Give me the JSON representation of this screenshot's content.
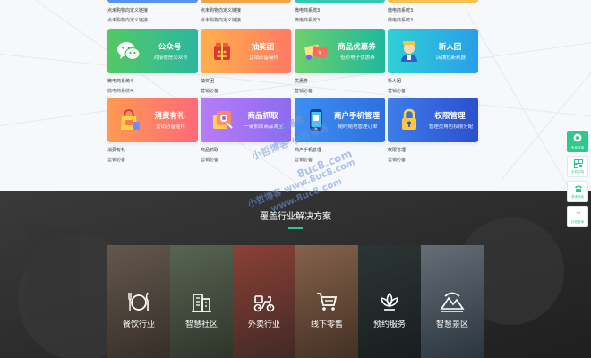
{
  "partial_row": [
    {
      "name": "点未购物向定义链接",
      "tag": "点未购物向定义链接",
      "color": "#5b8ff0"
    },
    {
      "name": "点未购物向定义链接",
      "tag": "点未购物向定义链接",
      "color": "#f5a24a"
    },
    {
      "name": "微电商系统3",
      "tag": "微电商系统3",
      "color": "#33c9b5"
    },
    {
      "name": "微电商系统3",
      "tag": "微电商系统3",
      "color": "#f3c24f"
    }
  ],
  "plugins": [
    {
      "title": "公众号",
      "subtitle": "对接微信公众号",
      "name": "微电商系统4",
      "tag": "微电商系统4",
      "icon": "wechat-icon",
      "colors": [
        "#52c964",
        "#2db6a0"
      ]
    },
    {
      "title": "抽奖团",
      "subtitle": "营销必备操作",
      "name": "抽奖团",
      "tag": "营销必备",
      "icon": "gift-box-icon",
      "colors": [
        "#ffb04a",
        "#ff7b63"
      ]
    },
    {
      "title": "商品优惠券",
      "subtitle": "低价电子优惠券",
      "name": "优惠券",
      "tag": "营销必备",
      "icon": "coupon-icon",
      "colors": [
        "#6dd06b",
        "#1fb89d"
      ]
    },
    {
      "title": "新人团",
      "subtitle": "店铺拉新利器",
      "name": "新人团",
      "tag": "营销必备",
      "icon": "new-user-icon",
      "colors": [
        "#2ed0d5",
        "#2a9ee8"
      ]
    },
    {
      "title": "消费有礼",
      "subtitle": "营销必备插件",
      "name": "消费有礼",
      "tag": "营销必备",
      "icon": "shopping-bag-icon",
      "colors": [
        "#ff9a52",
        "#ff6a78"
      ]
    },
    {
      "title": "商品抓取",
      "subtitle": "一键抓取商品淘宝",
      "name": "商品抓取",
      "tag": "营销必备",
      "icon": "product-grab-icon",
      "colors": [
        "#b77cf7",
        "#8b6bf0"
      ]
    },
    {
      "title": "商户手机管理",
      "subtitle": "随时随地管理订单",
      "name": "商户手机管理",
      "tag": "营销必备",
      "icon": "mobile-phone-icon",
      "colors": [
        "#3d8ff2",
        "#2e6fe0"
      ]
    },
    {
      "title": "权限管理",
      "subtitle": "管理员角色权限分配",
      "name": "权限管理",
      "tag": "营销必备",
      "icon": "lock-icon",
      "colors": [
        "#3d7de8",
        "#2c4fd0"
      ]
    }
  ],
  "watermark": [
    "小哲博客",
    "小哲博客 小哲博客",
    "8uc8.com",
    "小哲博客 www.8uc8.com",
    "www.8uc8.com"
  ],
  "industry": {
    "title": "覆盖行业解决方案",
    "items": [
      {
        "label": "餐饮行业",
        "icon": "dining-icon",
        "bg": [
          "#8a7a6a",
          "#4b423a"
        ]
      },
      {
        "label": "智慧社区",
        "icon": "building-icon",
        "bg": [
          "#7c8c72",
          "#3f4a3c"
        ]
      },
      {
        "label": "外卖行业",
        "icon": "scooter-icon",
        "bg": [
          "#c25a4c",
          "#5a3a34"
        ]
      },
      {
        "label": "线下零售",
        "icon": "cart-icon",
        "bg": [
          "#b8896a",
          "#5e4332"
        ]
      },
      {
        "label": "预约服务",
        "icon": "lotus-icon",
        "bg": [
          "#3e4a4a",
          "#222a2a"
        ]
      },
      {
        "label": "智慧景区",
        "icon": "landscape-icon",
        "bg": [
          "#8d99a4",
          "#3c4a56"
        ]
      }
    ]
  },
  "sidebar": [
    {
      "label": "免费试用",
      "icon": "online-service-icon",
      "active": true
    },
    {
      "label": "手机试用",
      "icon": "qr-code-icon",
      "active": false
    },
    {
      "label": "咨询热线",
      "icon": "telephone-icon",
      "active": false
    },
    {
      "label": "在线咨询",
      "icon": "qq-penguin-icon",
      "active": false
    }
  ]
}
